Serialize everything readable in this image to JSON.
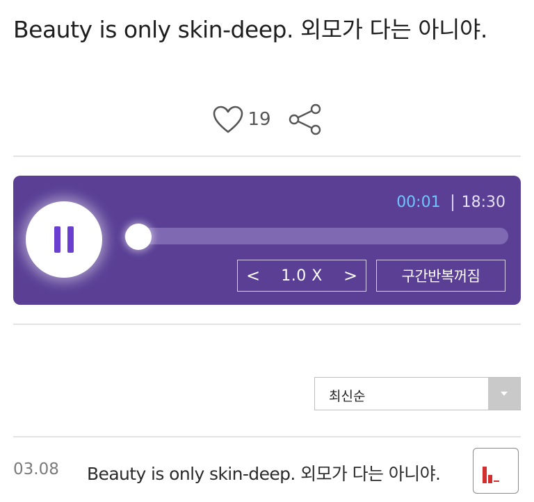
{
  "header": {
    "title": "Beauty is only skin-deep. 외모가 다는 아니야."
  },
  "social": {
    "like_icon": "heart-outline-icon",
    "like_count": "19",
    "share_icon": "share-icon"
  },
  "player": {
    "state": "playing",
    "control_icon": "pause-icon",
    "current_time": "00:01",
    "total_time": "18:30",
    "progress_fraction": 0.001,
    "speed_prev_label": "<",
    "speed": "1.0 X",
    "speed_next_label": ">",
    "repeat_label": "구간반복꺼짐",
    "colors": {
      "background": "#5a3f95",
      "current_time": "#6fc5ff",
      "pause_icon": "#6a3fd0"
    }
  },
  "sort": {
    "selected": "최신순",
    "dropdown_icon": "chevron-down-icon"
  },
  "list": {
    "items": [
      {
        "date": "03.08",
        "text": "Beauty is only skin-deep. 외모가 다는 아니야.",
        "icon": "chart-icon",
        "icon_color": "#d32f2f"
      }
    ]
  }
}
